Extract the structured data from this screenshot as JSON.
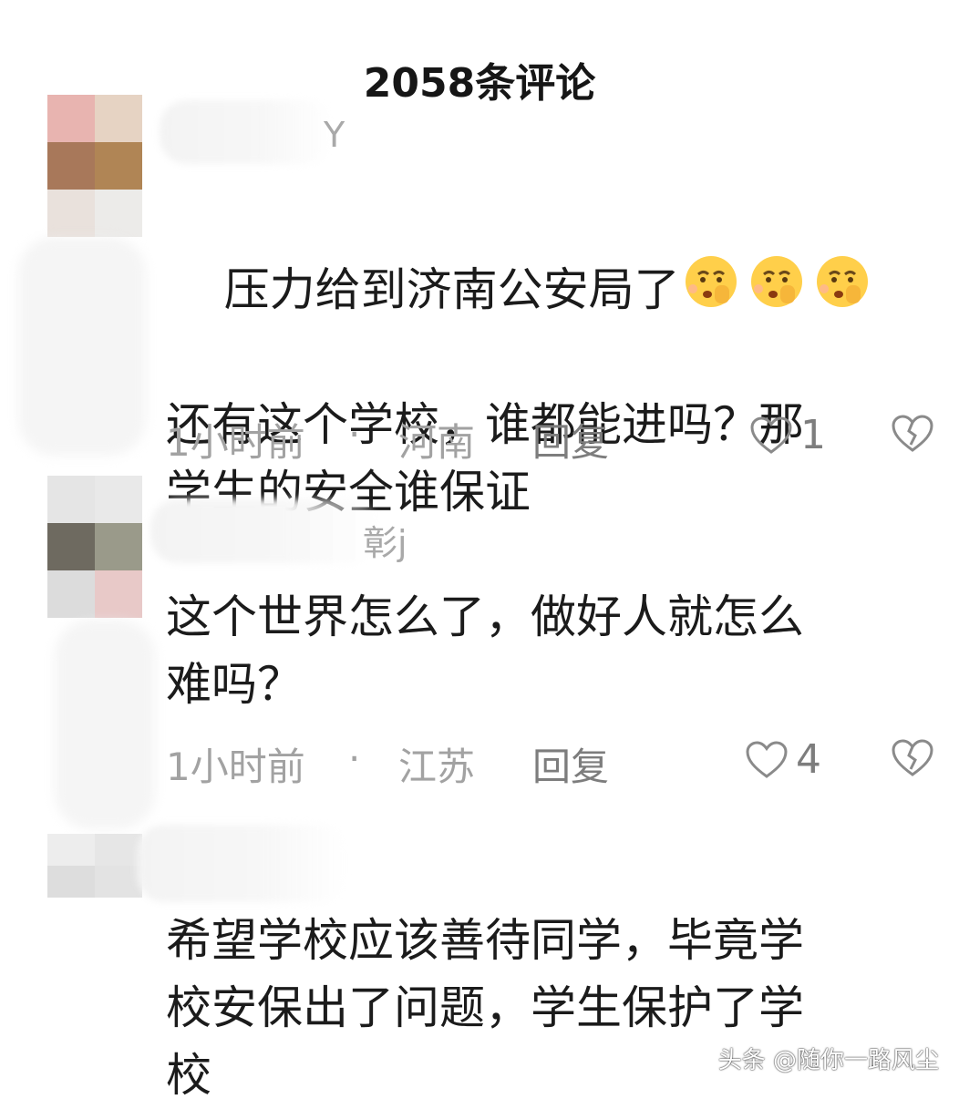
{
  "header": {
    "title": "2058条评论"
  },
  "comments": [
    {
      "name_tail": "Y",
      "text_line1": "压力给到济南公安局了",
      "text_rest": "还有这个学校，谁都能进吗？那\n学生的安全谁保证",
      "emoji": "fearful-shushing-emoji",
      "time": "1小时前",
      "dot": "·",
      "region": "河南",
      "reply": "回复",
      "likes": "1"
    },
    {
      "name_tail": "彰j",
      "text": "这个世界怎么了，做好人就怎么\n难吗？",
      "time": "1小时前",
      "dot": "·",
      "region": "江苏",
      "reply": "回复",
      "likes": "4"
    },
    {
      "text": "希望学校应该善待同学，毕竟学\n校安保出了问题，学生保护了学\n校"
    }
  ],
  "watermark": "头条 @随你一路风尘",
  "icons": {
    "like": "heart-outline-icon",
    "dislike": "broken-heart-icon"
  }
}
